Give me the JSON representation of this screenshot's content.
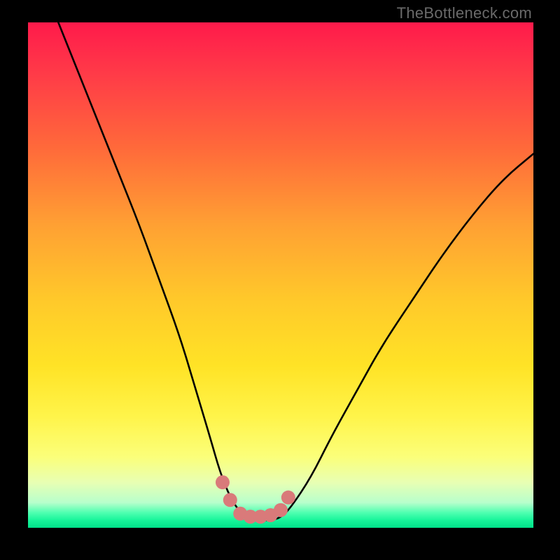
{
  "watermark": "TheBottleneck.com",
  "chart_data": {
    "type": "line",
    "title": "",
    "xlabel": "",
    "ylabel": "",
    "xlim": [
      0,
      100
    ],
    "ylim": [
      0,
      100
    ],
    "series": [
      {
        "name": "bottleneck-curve",
        "x": [
          6,
          10,
          14,
          18,
          22,
          26,
          30,
          33,
          36,
          38,
          40,
          42,
          44,
          46,
          48,
          50,
          52,
          56,
          60,
          65,
          70,
          76,
          82,
          88,
          94,
          100
        ],
        "values": [
          100,
          90,
          80,
          70,
          60,
          49,
          38,
          28,
          18,
          11,
          6,
          3,
          1.5,
          1.5,
          1.5,
          2,
          4,
          10,
          18,
          27,
          36,
          45,
          54,
          62,
          69,
          74
        ]
      },
      {
        "name": "highlight-dots",
        "x": [
          38.5,
          40,
          42,
          44,
          46,
          48,
          50,
          51.5
        ],
        "values": [
          9,
          5.5,
          2.8,
          2.2,
          2.2,
          2.5,
          3.5,
          6
        ]
      }
    ],
    "gradient_stops": [
      {
        "pos": 0,
        "color": "#ff1a4b"
      },
      {
        "pos": 25,
        "color": "#ff6a3a"
      },
      {
        "pos": 55,
        "color": "#ffc92a"
      },
      {
        "pos": 78,
        "color": "#fff44a"
      },
      {
        "pos": 95,
        "color": "#b8ffcc"
      },
      {
        "pos": 100,
        "color": "#00e28a"
      }
    ]
  }
}
